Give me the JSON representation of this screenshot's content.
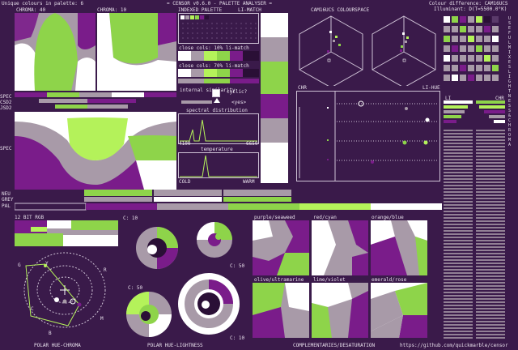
{
  "header": {
    "unique_colours": "Unique colours in palette: 6",
    "title": "= CENSOR v0.6.0 - PALETTE ANALYSER =",
    "colour_difference": "Colour difference: CAM16UCS",
    "illuminant": "Illuminant: D(T=5500.0°K)"
  },
  "panel_labels": {
    "chroma_40": "CHROMA: 40",
    "chroma_10": "CHROMA: 10",
    "indexed_palette": "INDEXED PALETTE",
    "li_match": "LI-MATCH",
    "cam16ucs": "CAM16UCS COLOURSPACE",
    "close_cols_10": "close cols: 10% li-match",
    "close_cols_70": "close cols: 70% li-match",
    "internal_similarity": "internal similarity",
    "cyclic": "cyclic?",
    "yes": "<yes>",
    "spectral_distribution": "spectral distribution",
    "spec_min": "4100",
    "spec_max": "6650",
    "temperature": "temperature",
    "temp_cold": "COLD",
    "temp_warm": "WARM",
    "chr": "CHR",
    "li_hue": "LI-HUE",
    "li": "LI",
    "chr2": "CHR",
    "vertical_label": "USEFUL MIXES   LIGHTNESS & CHROMA",
    "spec": "SPEC",
    "csd2": "CSD2",
    "jsd2": "JSD2",
    "spec_sd2": "SPEC SD2",
    "neu": "NEU",
    "grey": "GREY",
    "pal": "PAL",
    "bit_rgb": "12 BIT RGB",
    "c10a": "C: 10",
    "c50a": "C: 50",
    "c50b": "C: 50",
    "c10b": "C: 10",
    "purple_seaweed": "purple/seaweed",
    "red_cyan": "red/cyan",
    "orange_blue": "orange/blue",
    "olive_ultramarine": "olive/ultramarine",
    "lime_violet": "lime/violet",
    "emerald_rose": "emerald/rose",
    "polar_hue_chroma": "POLAR HUE-CHROMA",
    "polar_hue_lightness": "POLAR HUE-LIGHTNESS",
    "complementaries": "COMPLEMENTARIES/DESATURATION",
    "github": "https://github.com/quickmarble/censor"
  },
  "hue_letters": [
    "G",
    "Y",
    "R",
    "C",
    "B",
    "M"
  ],
  "colors": {
    "background": "#3a1a4a",
    "white": "#ffffff",
    "grey": "#a89aa8",
    "green": "#8ed44a",
    "lime": "#b4f25a",
    "purple": "#7a1c8a",
    "dark": "#2a0f36"
  }
}
